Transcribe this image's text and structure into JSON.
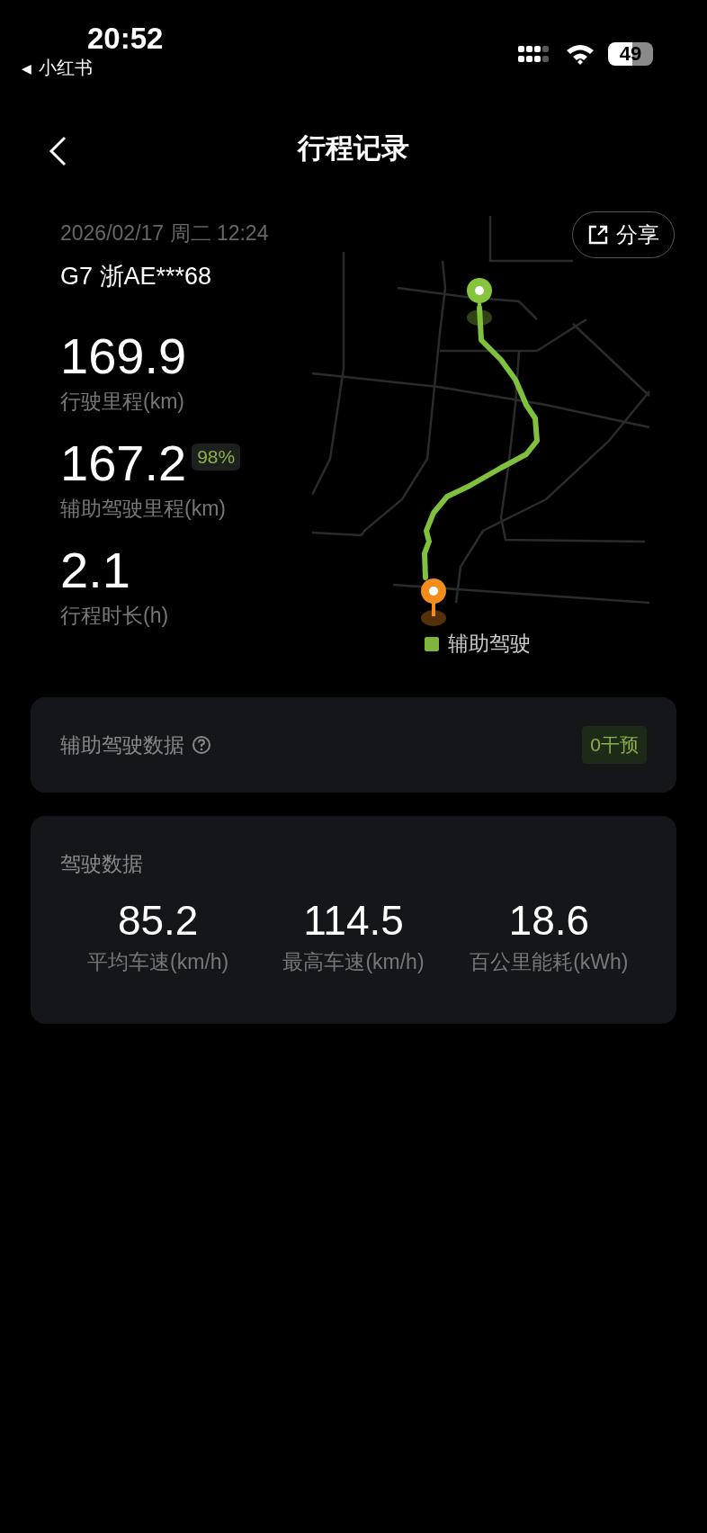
{
  "status_bar": {
    "time": "20:52",
    "back_arrow": "◀",
    "back_app": "小红书",
    "battery": "49"
  },
  "header": {
    "title": "行程记录"
  },
  "trip": {
    "date": "2026/02/17 周二 12:24",
    "vehicle": "G7 浙AE***68",
    "share": "分享",
    "stats": [
      {
        "value": "169.9",
        "label": "行驶里程(km)"
      },
      {
        "value": "167.2",
        "label": "辅助驾驶里程(km)",
        "badge": "98%"
      },
      {
        "value": "2.1",
        "label": "行程时长(h)"
      }
    ],
    "legend": "辅助驾驶"
  },
  "assist_card": {
    "title": "辅助驾驶数据",
    "tag": "0干预"
  },
  "driving_card": {
    "title": "驾驶数据",
    "metrics": [
      {
        "value": "85.2",
        "label": "平均车速(km/h)"
      },
      {
        "value": "114.5",
        "label": "最高车速(km/h)"
      },
      {
        "value": "18.6",
        "label": "百公里能耗(kWh)"
      }
    ]
  }
}
